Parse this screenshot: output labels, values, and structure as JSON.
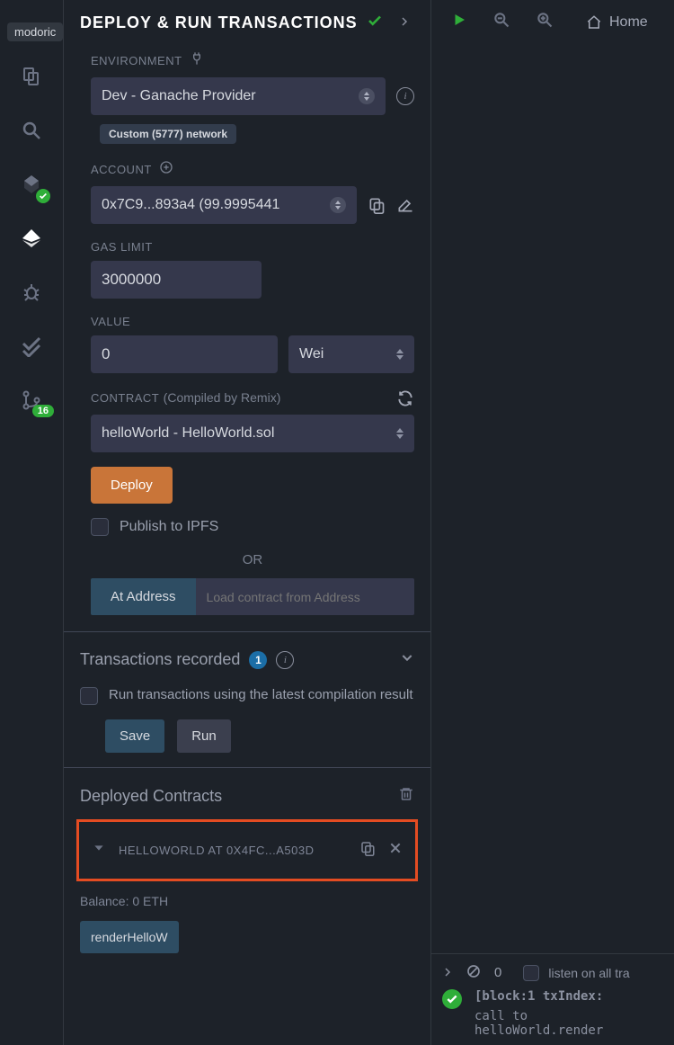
{
  "tooltip": "modoric",
  "iconbar": {
    "git_badge": "16"
  },
  "panel": {
    "title": "DEPLOY & RUN TRANSACTIONS",
    "environment_label": "ENVIRONMENT",
    "environment_value": "Dev - Ganache Provider",
    "network_badge": "Custom (5777) network",
    "account_label": "ACCOUNT",
    "account_value": "0x7C9...893a4 (99.9995441",
    "gas_limit_label": "GAS LIMIT",
    "gas_limit_value": "3000000",
    "value_label": "VALUE",
    "value_value": "0",
    "value_unit": "Wei",
    "contract_label": "CONTRACT",
    "contract_sublabel": "(Compiled by Remix)",
    "contract_value": "helloWorld - HelloWorld.sol",
    "deploy_btn": "Deploy",
    "publish_ipfs": "Publish to IPFS",
    "or_text": "OR",
    "at_address_btn": "At Address",
    "at_address_placeholder": "Load contract from Address"
  },
  "transactions": {
    "title": "Transactions recorded",
    "count": "1",
    "use_latest": "Run transactions using the latest compilation result",
    "save_btn": "Save",
    "run_btn": "Run"
  },
  "deployed": {
    "title": "Deployed Contracts",
    "item_name": "HELLOWORLD AT 0X4FC...A503D",
    "balance": "Balance: 0 ETH",
    "call_btn": "renderHelloW"
  },
  "right": {
    "home": "Home"
  },
  "terminal": {
    "count": "0",
    "listen_label": "listen on all tra",
    "log_block": "[block:1 txIndex:",
    "log_call": "call to helloWorld.render"
  }
}
